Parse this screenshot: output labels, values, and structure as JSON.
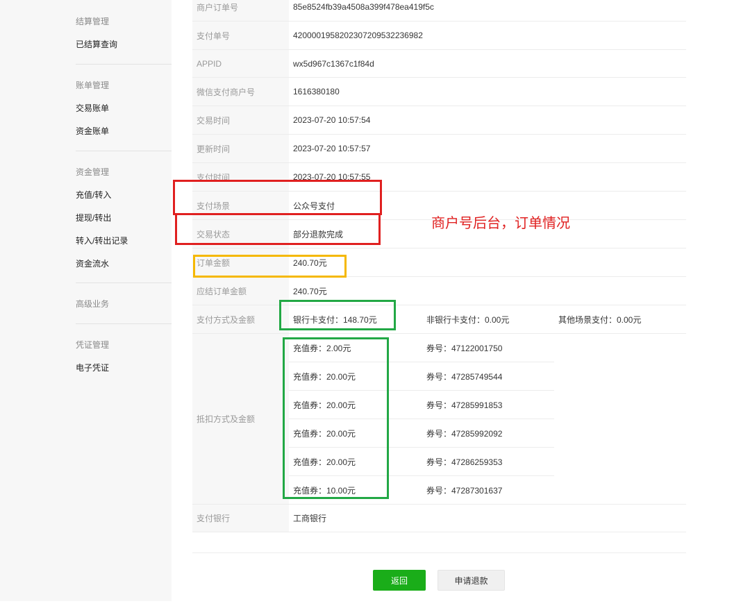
{
  "sidebar": {
    "groups": [
      {
        "title": "结算管理",
        "items": [
          "已结算查询"
        ]
      },
      {
        "title": "账单管理",
        "items": [
          "交易账单",
          "资金账单"
        ]
      },
      {
        "title": "资金管理",
        "items": [
          "充值/转入",
          "提现/转出",
          "转入/转出记录",
          "资金流水"
        ]
      },
      {
        "title": "高级业务",
        "items": []
      },
      {
        "title": "凭证管理",
        "items": [
          "电子凭证"
        ]
      }
    ]
  },
  "order": {
    "rows": [
      {
        "label": "商户订单号",
        "value": "85e8524fb39a4508a399f478ea419f5c"
      },
      {
        "label": "支付单号",
        "value": "4200001958202307209532236982"
      },
      {
        "label": "APPID",
        "value": "wx5d967c1367c1f84d"
      },
      {
        "label": "微信支付商户号",
        "value": "1616380180"
      },
      {
        "label": "交易时间",
        "value": "2023-07-20 10:57:54"
      },
      {
        "label": "更新时间",
        "value": "2023-07-20 10:57:57"
      },
      {
        "label": "支付时间",
        "value": "2023-07-20 10:57:55"
      },
      {
        "label": "支付场景",
        "value": "公众号支付"
      },
      {
        "label": "交易状态",
        "value": "部分退款完成"
      },
      {
        "label": "订单金额",
        "value": "240.70元"
      },
      {
        "label": "应结订单金额",
        "value": "240.70元"
      }
    ],
    "payment": {
      "label": "支付方式及金额",
      "bank_card": "银行卡支付：148.70元",
      "non_bank_card": "非银行卡支付：0.00元",
      "other_scene": "其他场景支付：0.00元"
    },
    "deduction": {
      "label": "抵扣方式及金额",
      "items": [
        {
          "amount": "充值券：2.00元",
          "coupon_no": "券号：47122001750"
        },
        {
          "amount": "充值券：20.00元",
          "coupon_no": "券号：47285749544"
        },
        {
          "amount": "充值券：20.00元",
          "coupon_no": "券号：47285991853"
        },
        {
          "amount": "充值券：20.00元",
          "coupon_no": "券号：47285992092"
        },
        {
          "amount": "充值券：20.00元",
          "coupon_no": "券号：47286259353"
        },
        {
          "amount": "充值券：10.00元",
          "coupon_no": "券号：47287301637"
        }
      ]
    },
    "bank": {
      "label": "支付银行",
      "value": "工商银行"
    }
  },
  "actions": {
    "back": "返回",
    "refund": "申请退款"
  },
  "annotation": {
    "text": "商户号后台，订单情况",
    "colors": {
      "red": "#e02020",
      "yellow": "#f5b800",
      "green": "#22a845"
    }
  }
}
